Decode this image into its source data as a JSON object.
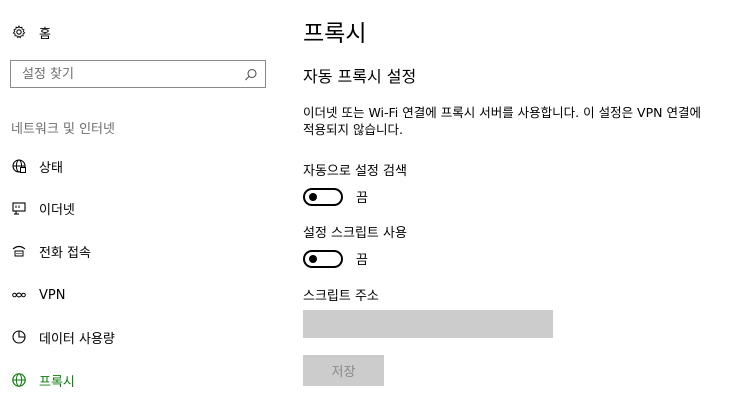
{
  "nav": {
    "home_label": "홈",
    "search_placeholder": "설정 찾기",
    "section_title": "네트워크 및 인터넷",
    "items": [
      {
        "label": "상태",
        "icon": "globe-status-icon"
      },
      {
        "label": "이더넷",
        "icon": "ethernet-icon"
      },
      {
        "label": "전화 접속",
        "icon": "dial-up-icon"
      },
      {
        "label": "VPN",
        "icon": "vpn-icon"
      },
      {
        "label": "데이터 사용량",
        "icon": "data-usage-icon"
      },
      {
        "label": "프록시",
        "icon": "globe-icon",
        "active": true
      }
    ],
    "accent_color": "#0a7d0a"
  },
  "main": {
    "title": "프록시",
    "section_title": "자동 프록시 설정",
    "description": "이더넷 또는 Wi-Fi 연결에 프록시 서버를 사용합니다. 이 설정은 VPN 연결에 적용되지 않습니다.",
    "auto_detect": {
      "label": "자동으로 설정 검색",
      "state": "끔"
    },
    "use_script": {
      "label": "설정 스크립트 사용",
      "state": "끔"
    },
    "script_address": {
      "label": "스크립트 주소",
      "value": ""
    },
    "save_label": "저장"
  }
}
